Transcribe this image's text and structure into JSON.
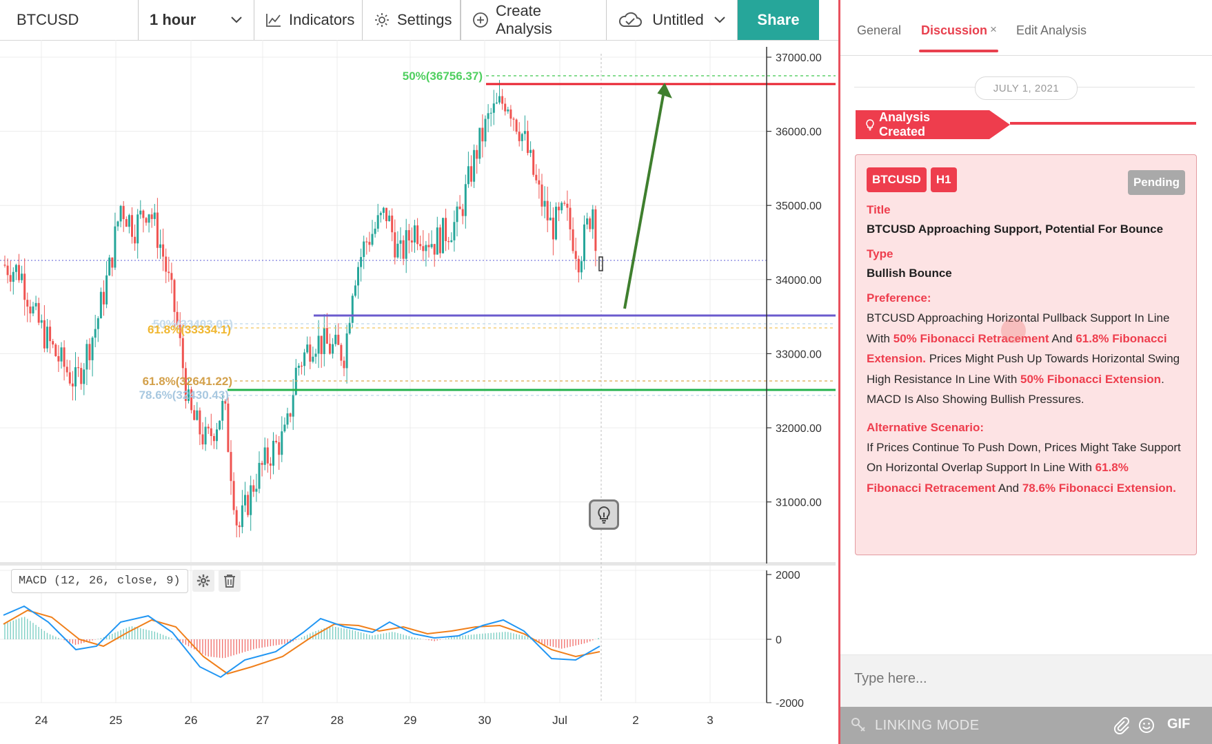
{
  "toolbar": {
    "symbol": "BTCUSD",
    "interval": "1 hour",
    "indicators": "Indicators",
    "settings": "Settings",
    "create_analysis": "Create Analysis",
    "layout_name": "Untitled",
    "share": "Share"
  },
  "chart": {
    "price_axis": [
      "37000.00",
      "36000.00",
      "35000.00",
      "34000.00",
      "33000.00",
      "32000.00",
      "31000.00"
    ],
    "time_axis": [
      "24",
      "25",
      "26",
      "27",
      "28",
      "29",
      "30",
      "Jul",
      "2",
      "3"
    ],
    "fib_labels": {
      "top_50": "50%(36756.37)",
      "mid_50": "50%(33403.05)",
      "mid_618": "61.8%(33334.1)",
      "low_618": "61.8%(32641.22)",
      "low_786": "78.6%(32430.43)"
    },
    "macd_label": "MACD (12, 26, close, 9)",
    "macd_axis": [
      "2000",
      "0",
      "-2000"
    ],
    "colors": {
      "up": "#26a69a",
      "down": "#ef5350",
      "resistance": "#e8202e",
      "support_blue": "#6a5acd",
      "support_green": "#22b24c",
      "arrow": "#3f7f2e"
    }
  },
  "panel": {
    "tabs": [
      "General",
      "Discussion",
      "Edit Analysis"
    ],
    "tab_close": "×",
    "date": "JULY 1, 2021",
    "created_label": "Analysis Created",
    "symbol_badge": "BTCUSD",
    "timeframe_badge": "H1",
    "status": "Pending",
    "title_label": "Title",
    "title_value": "BTCUSD Approaching Support, Potential For Bounce",
    "type_label": "Type",
    "type_value": "Bullish Bounce",
    "preference_label": "Preference:",
    "pref": {
      "t1": "BTCUSD Approaching Horizontal Pullback Support In Line With ",
      "h1": "50% Fibonacci Retracement",
      "t2": " And ",
      "h2": "61.8% Fibonacci Extension.",
      "t3": " Prices Might Push Up Towards Horizontal Swing High Resistance In Line With ",
      "h3": "50% Fibonacci Extension",
      "t4": ". MACD Is Also Showing Bullish Pressures."
    },
    "alternative_label": "Alternative Scenario:",
    "alt": {
      "t1": "If Prices Continue To Push Down, Prices Might Take Support On Horizontal Overlap Support In Line With ",
      "h1": "61.8% Fibonacci Retracement",
      "t2": " And ",
      "h2": "78.6% Fibonacci Extension."
    },
    "input_placeholder": "Type here...",
    "linking_mode": "LINKING MODE",
    "gif": "GIF"
  }
}
